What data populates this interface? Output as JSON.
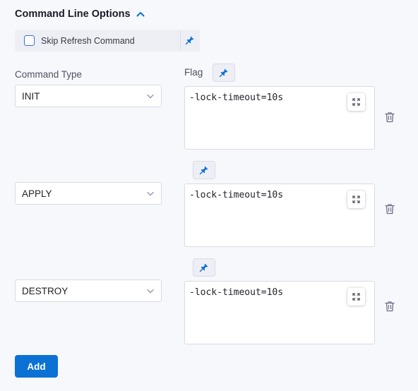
{
  "section": {
    "title": "Command Line Options",
    "icon": "chevron-up-icon"
  },
  "skip_refresh": {
    "label": "Skip Refresh Command",
    "checked": false
  },
  "columns": {
    "command_type": "Command Type",
    "flag": "Flag"
  },
  "rows": [
    {
      "command": "INIT",
      "flag": "-lock-timeout=10s"
    },
    {
      "command": "APPLY",
      "flag": "-lock-timeout=10s"
    },
    {
      "command": "DESTROY",
      "flag": "-lock-timeout=10s"
    }
  ],
  "add_button": {
    "label": "Add"
  },
  "colors": {
    "accent": "#0b71d5",
    "pin": "#0b71d5",
    "background": "#f7f8fb"
  }
}
